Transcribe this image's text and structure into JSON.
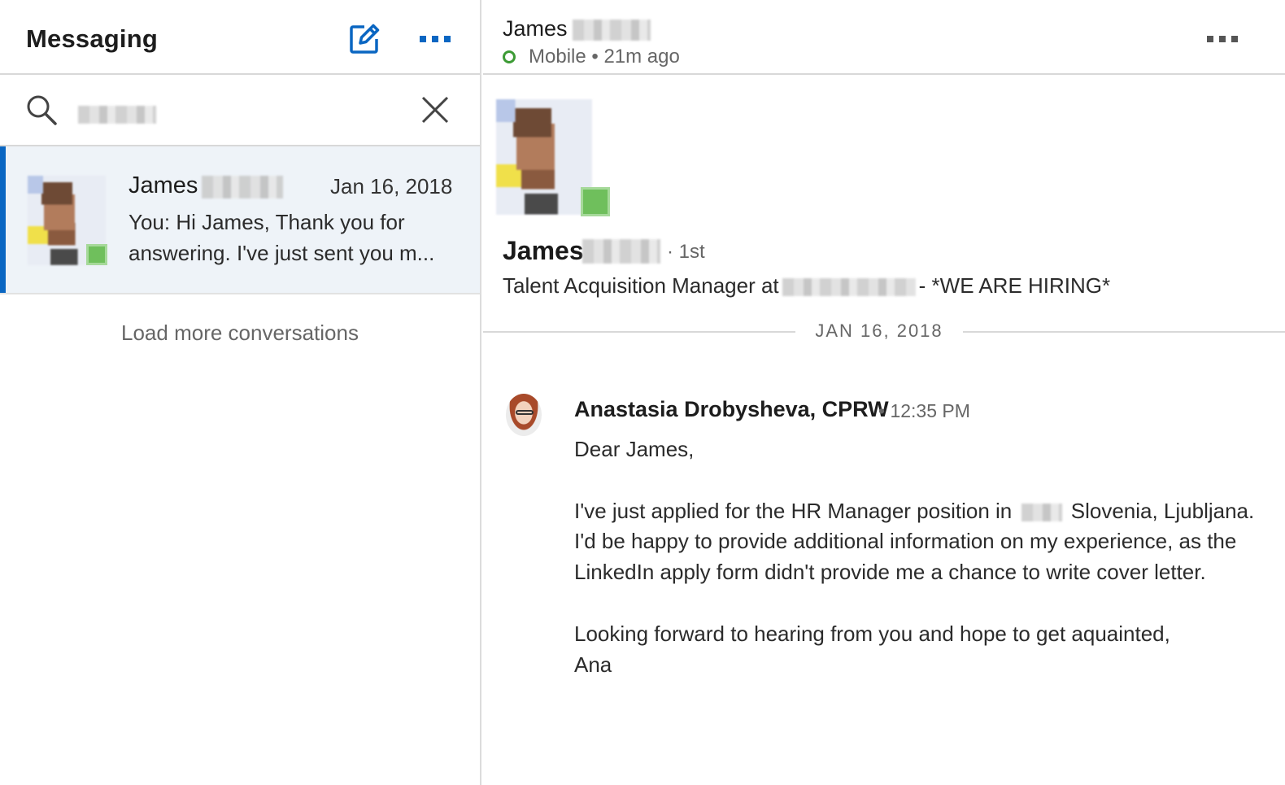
{
  "left_pane": {
    "title": "Messaging",
    "compose_icon": "compose-icon",
    "more_icon": "more-horizontal-icon",
    "search": {
      "icon": "search-icon",
      "value": "",
      "placeholder": "",
      "clear_icon": "close-icon"
    },
    "conversations": [
      {
        "name": "James",
        "date": "Jan 16, 2018",
        "snippet": "You: Hi James, Thank you for answering. I've just sent you m...",
        "active": true
      }
    ],
    "load_more_label": "Load more conversations"
  },
  "right_pane": {
    "header": {
      "name": "James",
      "status": "Mobile • 21m ago",
      "more_icon": "more-horizontal-icon"
    },
    "profile": {
      "name": "James",
      "degree": "· 1st",
      "headline_prefix": "Talent Acquisition Manager at",
      "headline_suffix": "- *WE ARE HIRING*"
    },
    "date_divider": "JAN 16, 2018",
    "message": {
      "sender": "Anastasia Drobysheva, CPRW",
      "time": "• 12:35 PM",
      "greeting": "Dear James,",
      "line1_before": "I've just applied for the HR Manager position in",
      "line1_after": "Slovenia, Ljubljana.",
      "line2": "I'd be happy to provide additional information on my experience, as the LinkedIn apply form didn't provide me a chance to write cover letter.",
      "closing": "Looking forward to hearing from you and hope to get aquainted,",
      "signature": "Ana"
    }
  },
  "colors": {
    "accent": "#0a66c2",
    "presence": "#3d9b35",
    "selected_bg": "#eef3f8"
  }
}
